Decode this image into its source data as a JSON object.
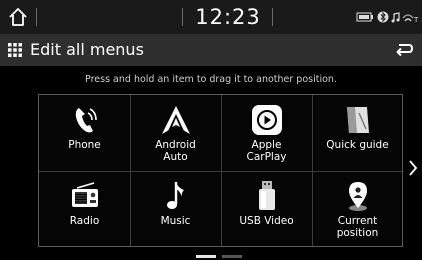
{
  "status_bar": {
    "time": "12:23",
    "icons": [
      "home-icon",
      "battery-icon",
      "bluetooth-icon",
      "signal-icon"
    ]
  },
  "title_bar": {
    "title": "Edit all menus",
    "icons": [
      "grid-menu-icon",
      "back-icon"
    ]
  },
  "hint": "Press and hold an item to drag it to another position.",
  "menu_items": [
    {
      "label": "Phone",
      "icon": "phone-icon"
    },
    {
      "label": "Android\nAuto",
      "icon": "android-auto-icon"
    },
    {
      "label": "Apple\nCarPlay",
      "icon": "apple-carplay-icon"
    },
    {
      "label": "Quick guide",
      "icon": "quick-guide-icon"
    },
    {
      "label": "Radio",
      "icon": "radio-icon"
    },
    {
      "label": "Music",
      "icon": "music-note-icon"
    },
    {
      "label": "USB Video",
      "icon": "usb-video-icon"
    },
    {
      "label": "Current\nposition",
      "icon": "location-pin-icon"
    }
  ],
  "pagination": {
    "pages": 2,
    "current": 1
  }
}
